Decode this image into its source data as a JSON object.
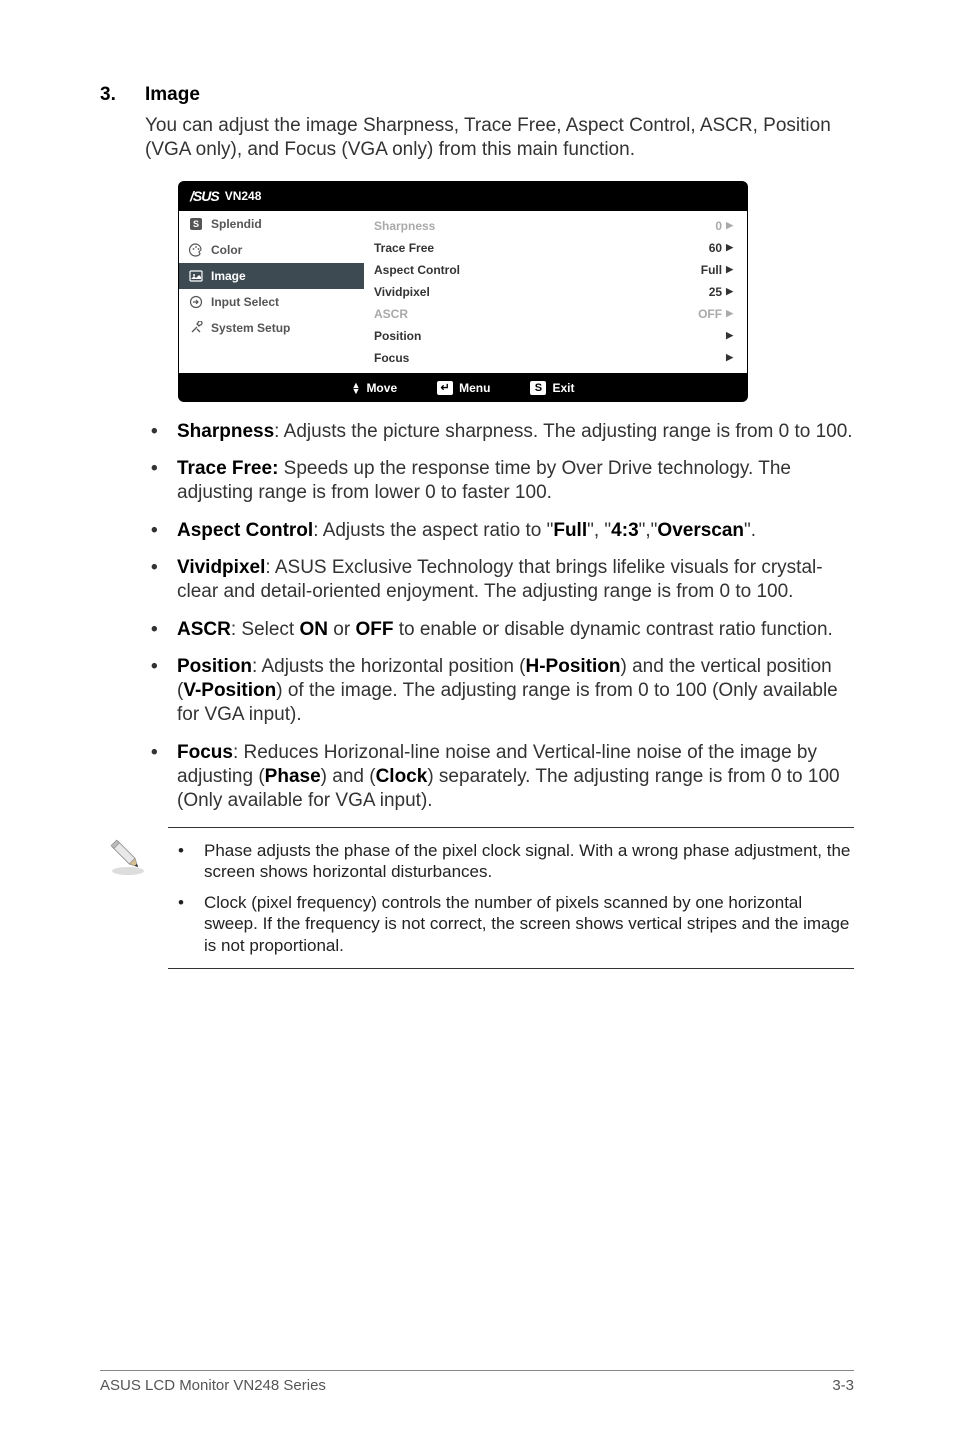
{
  "heading": {
    "num": "3.",
    "label": "Image"
  },
  "intro": "You can adjust the image Sharpness, Trace Free, Aspect Control, ASCR, Position (VGA only), and Focus (VGA only) from this main function.",
  "osd": {
    "brand": "/SUS",
    "model": "VN248",
    "menu": {
      "splendid": "Splendid",
      "color": "Color",
      "image": "Image",
      "input": "Input Select",
      "setup": "System Setup"
    },
    "rows": {
      "sharpness": {
        "label": "Sharpness",
        "value": "0"
      },
      "tracefree": {
        "label": "Trace Free",
        "value": "60"
      },
      "aspect": {
        "label": "Aspect Control",
        "value": "Full"
      },
      "vivid": {
        "label": "Vividpixel",
        "value": "25"
      },
      "ascr": {
        "label": "ASCR",
        "value": "OFF"
      },
      "position": {
        "label": "Position"
      },
      "focus": {
        "label": "Focus"
      }
    },
    "footer": {
      "move": "Move",
      "menu": "Menu",
      "exit": "Exit"
    }
  },
  "bullets": {
    "b1a": "Sharpness",
    "b1b": ": Adjusts the picture sharpness. The adjusting range is from 0 to 100.",
    "b2a": "Trace Free:",
    "b2b": " Speeds up the response time by Over Drive technology. The adjusting range is from lower 0 to faster 100.",
    "b3a": "Aspect Control",
    "b3b": ": Adjusts the aspect ratio to \"",
    "b3c": "Full",
    "b3d": "\", \"",
    "b3e": "4:3",
    "b3f": "\",\"",
    "b3g": "Overscan",
    "b3h": "\".",
    "b4a": "Vividpixel",
    "b4b": ": ASUS Exclusive Technology that brings lifelike visuals for crystal-clear and detail-oriented enjoyment. The adjusting range is from 0 to 100.",
    "b5a": "ASCR",
    "b5b": ": Select ",
    "b5c": "ON",
    "b5d": " or ",
    "b5e": "OFF",
    "b5f": " to enable or disable dynamic contrast ratio function.",
    "b6a": "Position",
    "b6b": ": Adjusts the horizontal position (",
    "b6c": "H-Position",
    "b6d": ") and the vertical position (",
    "b6e": "V-Position",
    "b6f": ") of the image. The adjusting range is from 0 to 100 (Only available for VGA input).",
    "b7a": "Focus",
    "b7b": ": Reduces Horizonal-line noise and Vertical-line noise of the image by adjusting (",
    "b7c": "Phase",
    "b7d": ") and (",
    "b7e": "Clock",
    "b7f": ") separately. The adjusting range is from 0 to 100 (Only available for VGA input)."
  },
  "notes": {
    "n1": "Phase adjusts the phase of the pixel clock signal. With a wrong phase adjustment, the screen shows horizontal disturbances.",
    "n2": "Clock (pixel frequency) controls the number of pixels scanned by one horizontal sweep. If the frequency is not correct, the screen shows vertical stripes and the image is not proportional."
  },
  "footer": {
    "left": "ASUS LCD Monitor VN248 Series",
    "right": "3-3"
  }
}
